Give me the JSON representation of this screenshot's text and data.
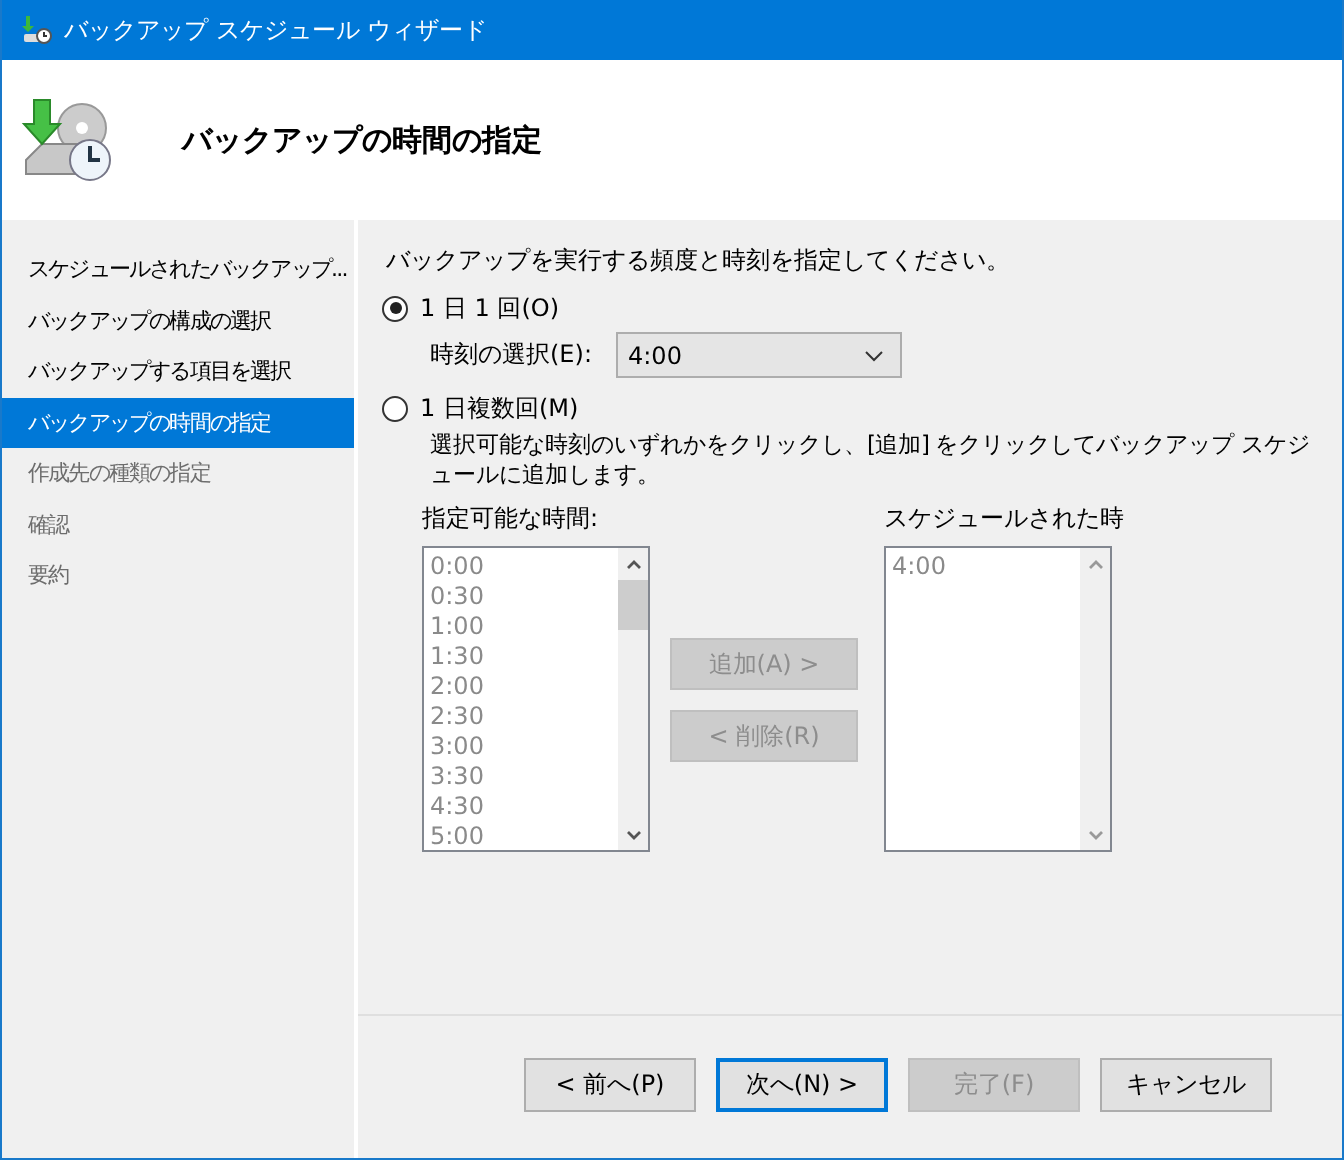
{
  "window": {
    "title": "バックアップ スケジュール ウィザード"
  },
  "header": {
    "title": "バックアップの時間の指定"
  },
  "sidebar": {
    "items": [
      {
        "label": "スケジュールされたバックアップ...",
        "selected": false,
        "disabled": false
      },
      {
        "label": "バックアップの構成の選択",
        "selected": false,
        "disabled": false
      },
      {
        "label": "バックアップする項目を選択",
        "selected": false,
        "disabled": false
      },
      {
        "label": "バックアップの時間の指定",
        "selected": true,
        "disabled": false
      },
      {
        "label": "作成先の種類の指定",
        "selected": false,
        "disabled": true
      },
      {
        "label": "確認",
        "selected": false,
        "disabled": true
      },
      {
        "label": "要約",
        "selected": false,
        "disabled": true
      }
    ]
  },
  "content": {
    "instruction": "バックアップを実行する頻度と時刻を指定してください。",
    "options": [
      {
        "label": "1 日 1 回(O)",
        "selected": true
      },
      {
        "label": "1 日複数回(M)",
        "selected": false
      }
    ],
    "time_select": {
      "label": "時刻の選択(E):",
      "value": "4:00"
    },
    "multi_description": "選択可能な時刻のいずれかをクリックし、[追加] をクリックしてバックアップ スケジュールに追加します。",
    "available": {
      "label": "指定可能な時間:",
      "disabled": true,
      "items": [
        "0:00",
        "0:30",
        "1:00",
        "1:30",
        "2:00",
        "2:30",
        "3:00",
        "3:30",
        "4:30",
        "5:00"
      ]
    },
    "list_buttons": [
      {
        "label": "追加(A) >",
        "disabled": true
      },
      {
        "label": "< 削除(R)",
        "disabled": true
      }
    ],
    "scheduled": {
      "label": "スケジュールされた時",
      "disabled": true,
      "items": [
        "4:00"
      ]
    }
  },
  "buttons": [
    {
      "label": "< 前へ(P)",
      "disabled": false,
      "default": false
    },
    {
      "label": "次へ(N) >",
      "disabled": false,
      "default": true
    },
    {
      "label": "完了(F)",
      "disabled": true,
      "default": false
    },
    {
      "label": "キャンセル",
      "disabled": false,
      "default": false
    }
  ]
}
